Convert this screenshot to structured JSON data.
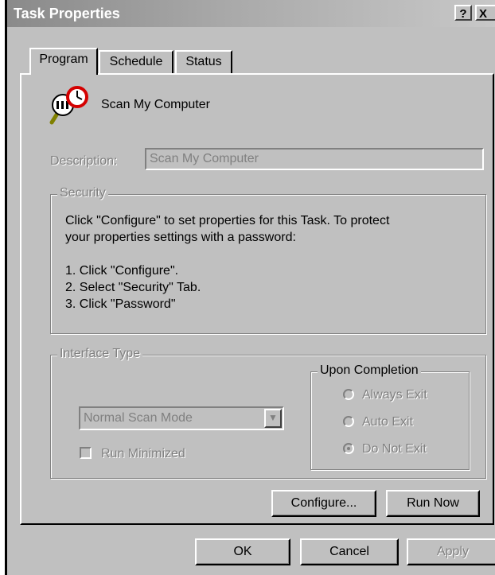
{
  "window": {
    "title": "Task Properties",
    "help_button": "?",
    "close_button": "X"
  },
  "tabs": [
    {
      "label": "Program",
      "active": true
    },
    {
      "label": "Schedule",
      "active": false
    },
    {
      "label": "Status",
      "active": false
    }
  ],
  "program": {
    "app_name": "Scan My Computer",
    "app_icon": "magnifier-clock-icon",
    "description_label": "Description:",
    "description_value": "Scan My Computer"
  },
  "security": {
    "legend": "Security",
    "intro_line1": "Click \"Configure\" to set properties for this Task. To protect",
    "intro_line2": "your properties settings with a password:",
    "steps": [
      "1. Click \"Configure\".",
      "2. Select \"Security\" Tab.",
      "3. Click \"Password\""
    ]
  },
  "interface": {
    "legend": "Interface Type",
    "scan_mode": "Normal Scan Mode",
    "run_minimized_label": "Run Minimized",
    "run_minimized_checked": false
  },
  "completion": {
    "legend": "Upon Completion",
    "options": [
      {
        "label": "Always Exit",
        "selected": false
      },
      {
        "label": "Auto Exit",
        "selected": false
      },
      {
        "label": "Do Not Exit",
        "selected": true
      }
    ]
  },
  "buttons": {
    "configure": "Configure...",
    "run_now": "Run Now",
    "ok": "OK",
    "cancel": "Cancel",
    "apply": "Apply"
  },
  "colors": {
    "face": "#c0c0c0",
    "disabled_text": "#808080",
    "icon_red": "#d40000"
  }
}
